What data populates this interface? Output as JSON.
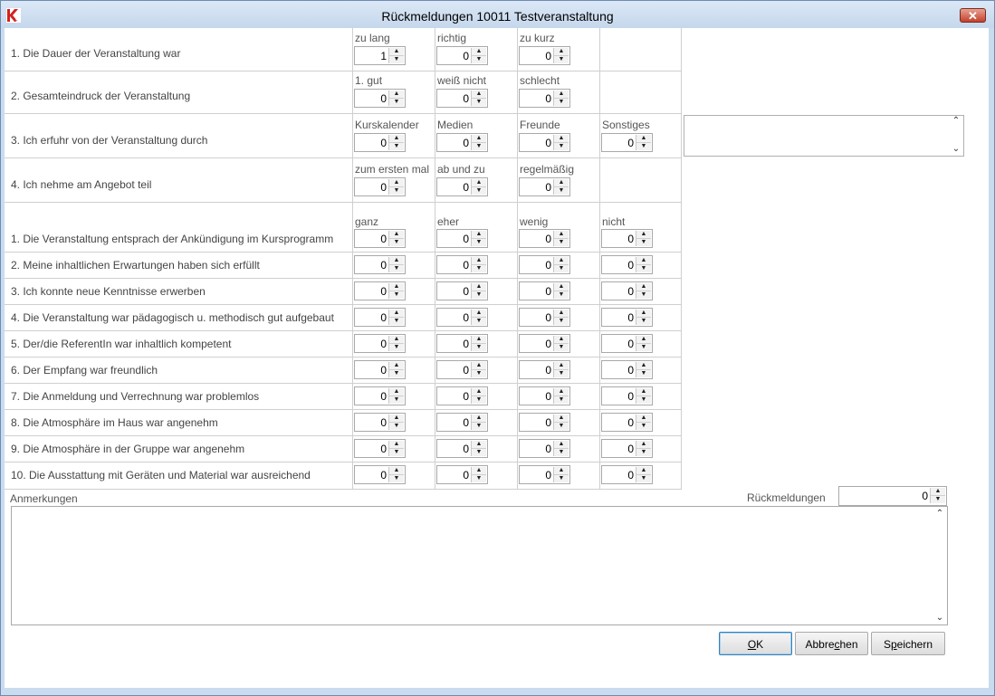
{
  "window": {
    "title": "Rückmeldungen 10011  Testveranstaltung",
    "close_symbol": "✕"
  },
  "colors": {
    "title_bar": "#c5d7ec",
    "close_button": "#c4402c",
    "logo_red": "#d3211f",
    "grid": "#cfcfcf"
  },
  "icons": {
    "logo": "k9-app-logo-icon",
    "close": "close-icon",
    "spin_up": "spin-up-arrow-icon",
    "spin_down": "spin-down-arrow-icon",
    "scroll_up": "scroll-up-arrow-icon",
    "scroll_down": "scroll-down-arrow-icon"
  },
  "spin_glyphs": {
    "up": "▲",
    "down": "▼",
    "scroll_up": "⌃",
    "scroll_down": "⌄"
  },
  "top_questions": [
    {
      "label": "1. Die Dauer der Veranstaltung war",
      "options": [
        {
          "label": "zu lang",
          "value": "1"
        },
        {
          "label": "richtig",
          "value": "0"
        },
        {
          "label": "zu kurz",
          "value": "0"
        }
      ]
    },
    {
      "label": "2. Gesamteindruck der Veranstaltung",
      "options": [
        {
          "label": "1. gut",
          "value": "0"
        },
        {
          "label": "weiß nicht",
          "value": "0"
        },
        {
          "label": "schlecht",
          "value": "0"
        }
      ]
    },
    {
      "label": "3. Ich erfuhr von der Veranstaltung durch",
      "options": [
        {
          "label": "Kurskalender",
          "value": "0"
        },
        {
          "label": "Medien",
          "value": "0"
        },
        {
          "label": "Freunde",
          "value": "0"
        },
        {
          "label": "Sonstiges",
          "value": "0"
        }
      ]
    },
    {
      "label": "4. Ich nehme am Angebot teil",
      "options": [
        {
          "label": "zum ersten mal",
          "value": "0"
        },
        {
          "label": "ab und zu",
          "value": "0"
        },
        {
          "label": "regelmäßig",
          "value": "0"
        }
      ]
    }
  ],
  "rating_columns": [
    "ganz",
    "eher",
    "wenig",
    "nicht"
  ],
  "rating_questions": [
    {
      "label": "1. Die Veranstaltung entsprach der Ankündigung im Kursprogramm",
      "values": [
        "0",
        "0",
        "0",
        "0"
      ]
    },
    {
      "label": "2. Meine inhaltlichen Erwartungen haben sich erfüllt",
      "values": [
        "0",
        "0",
        "0",
        "0"
      ]
    },
    {
      "label": "3. Ich konnte neue Kenntnisse erwerben",
      "values": [
        "0",
        "0",
        "0",
        "0"
      ]
    },
    {
      "label": "4. Die Veranstaltung war pädagogisch u. methodisch gut aufgebaut",
      "values": [
        "0",
        "0",
        "0",
        "0"
      ]
    },
    {
      "label": "5. Der/die ReferentIn war inhaltlich kompetent",
      "values": [
        "0",
        "0",
        "0",
        "0"
      ]
    },
    {
      "label": "6. Der Empfang war freundlich",
      "values": [
        "0",
        "0",
        "0",
        "0"
      ]
    },
    {
      "label": "7. Die Anmeldung und Verrechnung war problemlos",
      "values": [
        "0",
        "0",
        "0",
        "0"
      ]
    },
    {
      "label": "8. Die Atmosphäre im Haus war angenehm",
      "values": [
        "0",
        "0",
        "0",
        "0"
      ]
    },
    {
      "label": "9. Die Atmosphäre in der Gruppe war angenehm",
      "values": [
        "0",
        "0",
        "0",
        "0"
      ]
    },
    {
      "label": "10. Die Ausstattung mit Geräten und Material war ausreichend",
      "values": [
        "0",
        "0",
        "0",
        "0"
      ]
    }
  ],
  "sonstiges_text": "",
  "remarks": {
    "label": "Anmerkungen",
    "value": ""
  },
  "feedback_count": {
    "label": "Rückmeldungen",
    "value": "0"
  },
  "buttons": {
    "ok": {
      "mnemonic": "O",
      "rest": "K"
    },
    "cancel": {
      "before": "Abbre",
      "mnemonic": "c",
      "after": "hen"
    },
    "save": {
      "before": "S",
      "mnemonic": "p",
      "after": "eichern"
    }
  }
}
